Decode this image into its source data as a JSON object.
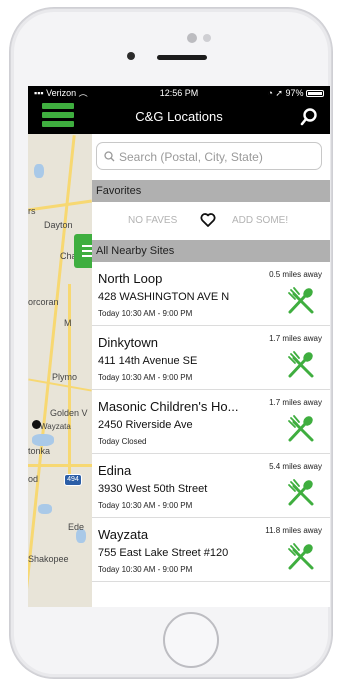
{
  "status": {
    "carrier": "Verizon",
    "time": "12:56 PM",
    "battery": "97%"
  },
  "nav": {
    "title": "C&G Locations"
  },
  "search": {
    "placeholder": "Search (Postal, City, State)"
  },
  "favorites": {
    "header": "Favorites",
    "no_faves": "NO FAVES",
    "add_some": "ADD SOME!"
  },
  "nearby": {
    "header": "All Nearby Sites",
    "sites": [
      {
        "name": "North Loop",
        "address": "428 WASHINGTON AVE N",
        "hours": "Today 10:30 AM - 9:00 PM",
        "distance": "0.5 miles away"
      },
      {
        "name": "Dinkytown",
        "address": "411 14th Avenue SE",
        "hours": "Today 10:30 AM - 9:00 PM",
        "distance": "1.7 miles away"
      },
      {
        "name": "Masonic Children's Ho...",
        "address": "2450 Riverside Ave",
        "hours": "Today Closed",
        "distance": "1.7 miles away"
      },
      {
        "name": "Edina",
        "address": "3930 West 50th Street",
        "hours": "Today 10:30 AM - 9:00 PM",
        "distance": "5.4 miles away"
      },
      {
        "name": "Wayzata",
        "address": "755 East Lake Street #120",
        "hours": "Today 10:30 AM - 9:00 PM",
        "distance": "11.8 miles away"
      }
    ]
  },
  "map": {
    "labels": [
      "rs",
      "Dayton",
      "Champ",
      "orcoran",
      "M",
      "Plymo",
      "Golden V",
      "Wayzata",
      "tonka",
      "od",
      "Ede",
      "Shakopee"
    ],
    "highway": "494"
  },
  "colors": {
    "accent": "#3fae3f",
    "bar": "#000000",
    "section": "#b0b0b0"
  }
}
